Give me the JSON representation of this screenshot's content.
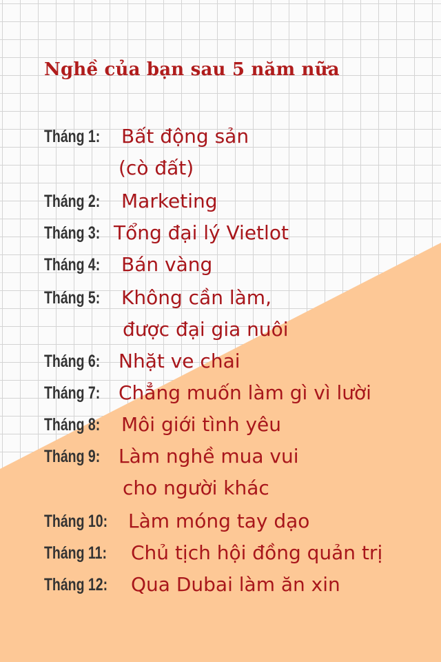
{
  "title": "Nghề của bạn sau 5 năm nữa",
  "colors": {
    "title": "#b01c1c",
    "month_label": "#333333",
    "job_text": "#a8161b",
    "peach_background": "#fdc896",
    "grid_line": "#d4d4d4",
    "paper": "#fbfbfb"
  },
  "items": [
    {
      "month": "Tháng 1:",
      "job": "Bất động sản",
      "job_cont": "(cò đất)"
    },
    {
      "month": "Tháng 2:",
      "job": "Marketing"
    },
    {
      "month": "Tháng 3:",
      "job": "Tổng đại lý Vietlot"
    },
    {
      "month": "Tháng 4:",
      "job": "Bán vàng"
    },
    {
      "month": "Tháng 5:",
      "job": "Không cần làm,",
      "job_cont": "được đại gia nuôi"
    },
    {
      "month": "Tháng 6:",
      "job": "Nhặt ve chai"
    },
    {
      "month": "Tháng 7:",
      "job": "Chẳng muốn làm gì vì lười"
    },
    {
      "month": "Tháng 8:",
      "job": "Môi giới tình yêu"
    },
    {
      "month": "Tháng 9:",
      "job": "Làm nghề mua vui",
      "job_cont": "cho người khác"
    },
    {
      "month": "Tháng 10:",
      "job": "Làm móng tay dạo"
    },
    {
      "month": "Tháng 11:",
      "job": "Chủ tịch hội đồng quản trị"
    },
    {
      "month": "Tháng 12:",
      "job": "Qua Dubai làm ăn xin"
    }
  ]
}
